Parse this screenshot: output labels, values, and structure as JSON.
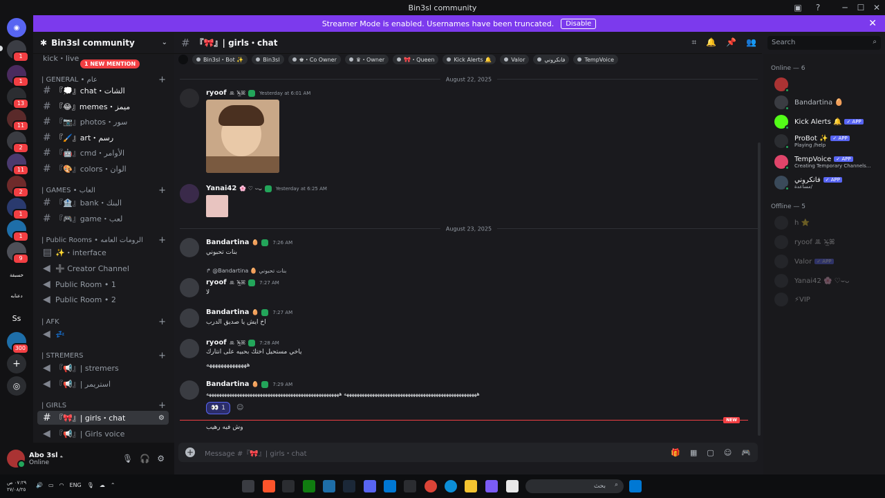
{
  "window": {
    "title": "Bin3sl community"
  },
  "banner": {
    "text": "Streamer Mode is enabled. Usernames have been truncated.",
    "disable_label": "Disable"
  },
  "rail": {
    "badges": [
      "1",
      "1",
      "13",
      "11",
      "2",
      "11",
      "2",
      "1",
      "1",
      "9",
      "300"
    ],
    "labels": [
      "خسبقة",
      "دعنابه",
      "Ss"
    ]
  },
  "guild": {
    "name": "Bin3sl community",
    "new_mention": "1 NEW MENTION"
  },
  "sidebar": {
    "top_partial": "kick・live",
    "categories": {
      "general": "| GENERAL • عام",
      "games": "| GAMES • العاب",
      "public_rooms": "| Public Rooms • الرومات العامه",
      "afk": "| AFK",
      "stremers": "| STREMERS",
      "girls": "| GIRLS"
    },
    "channels": {
      "chat": "『💭』chat・الشات",
      "memes": "『😂』memes・ميمز",
      "photos": "『📷』photos・سور",
      "art": "『🖌️』art・رسم",
      "cmd": "『🤖』cmd・الأوامر",
      "colors": "『🎨』colors・الوان",
      "bank": "『🏦』bank・البنك",
      "game": "『🎮』game・لعب",
      "interface": "✨・interface",
      "creator": "➕ Creator Channel",
      "public1": "Public Room • 1",
      "public2": "Public Room • 2",
      "afk": "💤",
      "stremers": "『📢』| stremers",
      "stremers2": "『📢』| استريمر",
      "girls_chat": "『🎀』| girls・chat",
      "girls_voice": "『📢』| Girls voice"
    }
  },
  "user": {
    "name": "Abo 3sl ۦ",
    "status": "Online"
  },
  "chat": {
    "channel": "『🎀』| girls・chat",
    "roles": [
      "Bin3sl・Bot ✨",
      "Bin3sl",
      "♚・Co Owner",
      "♛・Owner",
      "🎀・Queen",
      "Kick Alerts 🔔",
      "Valor",
      "فانكروني",
      "TempVoice"
    ],
    "divider1": "August 22, 2025",
    "divider2": "August 23, 2025",
    "messages": [
      {
        "author": "ryoof",
        "tag": "ꔛ 𝕏̶̲ꕤ",
        "time": "Yesterday at 6:01 AM",
        "text": ""
      },
      {
        "author": "Yanai42",
        "tag": "🌸 ♡ ⌣ᴗ",
        "time": "Yesterday at 6:25 AM",
        "text": ""
      },
      {
        "author": "Bandartina",
        "tag": "🥚",
        "time": "7:26 AM",
        "text": "بنات تحبوني"
      },
      {
        "author": "ryoof",
        "tag": "ꔛ 𝕏̶̲ꕤ",
        "time": "7:27 AM",
        "text": "لا",
        "reply": "@Bandartina 🥚 بنات تحبوني"
      },
      {
        "author": "Bandartina",
        "tag": "🥚",
        "time": "7:27 AM",
        "text": "اخ ايش يا صديق الدرب"
      },
      {
        "author": "ryoof",
        "tag": "ꔛ 𝕏̶̲ꕤ",
        "time": "7:28 AM",
        "text": "ياخي مستحيل اختك بحبيه على انتارك",
        "text2": "ههههههههههههههه"
      },
      {
        "author": "Bandartina",
        "tag": "🥚",
        "time": "7:29 AM",
        "text": "ههههههههههههههههههههههههههههههههههههههههههههههههههههه ههههههههههههههههههههههههههههههههههههههههههههههههههههه"
      }
    ],
    "reaction": {
      "emoji": "👀",
      "count": "1"
    },
    "new_label": "NEW",
    "last_text": "وش فيه رهيب",
    "placeholder": "Message #『🎀』| girls・chat"
  },
  "search": {
    "placeholder": "Search"
  },
  "members": {
    "online_header": "Online — 6",
    "offline_header": "Offline — 5",
    "online": [
      {
        "name": "",
        "sub": ""
      },
      {
        "name": "Bandartina 🥚",
        "sub": ""
      },
      {
        "name": "Kick Alerts 🔔",
        "sub": "",
        "app": "✓ APP"
      },
      {
        "name": "ProBot ✨",
        "sub": "Playing /help",
        "app": "✓ APP"
      },
      {
        "name": "TempVoice",
        "sub": "Creating Temporary Channels...",
        "app": "✓ APP"
      },
      {
        "name": "فانكروني",
        "sub": "مساعدة/",
        "app": "✓ APP"
      }
    ],
    "offline": [
      {
        "name": "h ⭐"
      },
      {
        "name": "ryoof ꔛ 𝕏̶̲ꕤ"
      },
      {
        "name": "Valor",
        "app": "✓ APP"
      },
      {
        "name": "Yanai42 🌸 ♡⌣ᴗ"
      },
      {
        "name": "⚡VIP"
      }
    ]
  },
  "taskbar": {
    "time": "٠٧:٢٩ ص",
    "date": "٢٧/٠٨/٢٥",
    "lang": "ENG",
    "search": "بحث"
  }
}
